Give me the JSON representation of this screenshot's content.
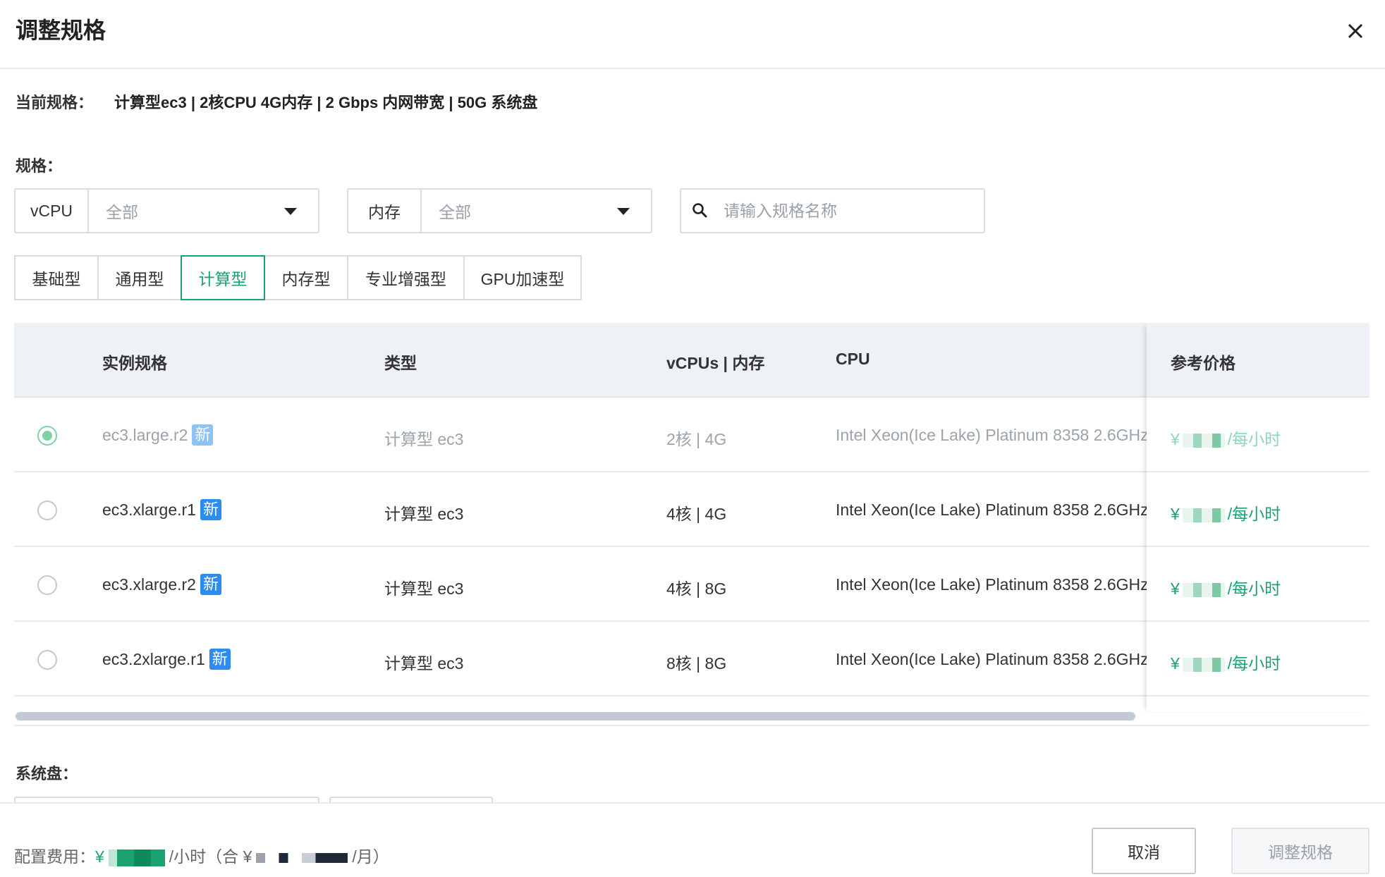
{
  "dialog": {
    "title": "调整规格"
  },
  "current": {
    "label": "当前规格：",
    "value": "计算型ec3 | 2核CPU 4G内存 | 2 Gbps 内网带宽 | 50G 系统盘"
  },
  "spec": {
    "label": "规格：",
    "vcpu_filter": {
      "label": "vCPU",
      "value": "全部"
    },
    "memory_filter": {
      "label": "内存",
      "value": "全部"
    },
    "search_placeholder": "请输入规格名称"
  },
  "tabs": [
    {
      "label": "基础型",
      "active": false
    },
    {
      "label": "通用型",
      "active": false
    },
    {
      "label": "计算型",
      "active": true
    },
    {
      "label": "内存型",
      "active": false
    },
    {
      "label": "专业增强型",
      "active": false
    },
    {
      "label": "GPU加速型",
      "active": false
    }
  ],
  "table": {
    "headers": {
      "spec": "实例规格",
      "type": "类型",
      "vcpu_mem": "vCPUs | 内存",
      "cpu": "CPU",
      "price": "参考价格"
    },
    "new_badge": "新",
    "rows": [
      {
        "spec": "ec3.large.r2",
        "type": "计算型 ec3",
        "vcpu_mem": "2核 | 4G",
        "cpu": "Intel Xeon(Ice Lake) Platinum 8358 2.6GHz",
        "price_prefix": "¥",
        "price_unit": "/每小时",
        "selected": true
      },
      {
        "spec": "ec3.xlarge.r1",
        "type": "计算型 ec3",
        "vcpu_mem": "4核 | 4G",
        "cpu": "Intel Xeon(Ice Lake) Platinum 8358 2.6GHz",
        "price_prefix": "¥",
        "price_unit": "/每小时",
        "selected": false
      },
      {
        "spec": "ec3.xlarge.r2",
        "type": "计算型 ec3",
        "vcpu_mem": "4核 | 8G",
        "cpu": "Intel Xeon(Ice Lake) Platinum 8358 2.6GHz",
        "price_prefix": "¥",
        "price_unit": "/每小时",
        "selected": false
      },
      {
        "spec": "ec3.2xlarge.r1",
        "type": "计算型 ec3",
        "vcpu_mem": "8核 | 8G",
        "cpu": "Intel Xeon(Ice Lake) Platinum 8358 2.6GHz",
        "price_prefix": "¥",
        "price_unit": "/每小时",
        "selected": false
      }
    ]
  },
  "system_disk": {
    "label": "系统盘："
  },
  "footer": {
    "fee_label": "配置费用：",
    "fee_prefix": "¥",
    "fee_hour_unit": "/小时（合 ¥",
    "fee_month_unit": "/月）",
    "cancel_label": "取消",
    "submit_label": "调整规格"
  },
  "colors": {
    "accent": "#1aa36e",
    "new_badge": "#2d8cf0",
    "border": "#d9dde3"
  },
  "icons": {
    "close": "close-icon",
    "search": "search-icon",
    "dropdown": "caret-down-icon",
    "radio": "radio-icon"
  }
}
